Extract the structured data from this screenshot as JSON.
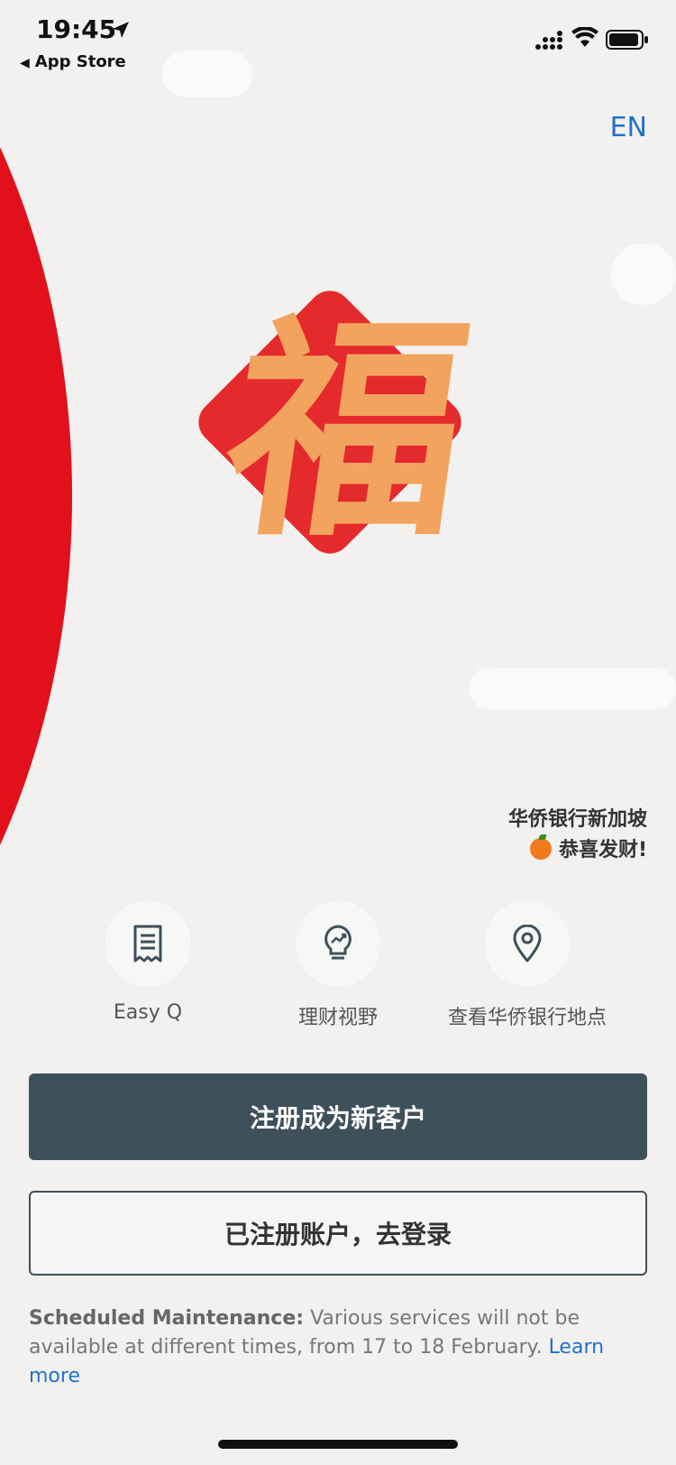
{
  "status_bar": {
    "time": "19:45",
    "back_app": "App Store",
    "icons": [
      "location-arrow-icon",
      "cellular-signal-icon",
      "wifi-icon",
      "battery-icon"
    ]
  },
  "header": {
    "language_toggle": "EN"
  },
  "hero": {
    "character": "福",
    "greeting_line1": "华侨银行新加坡",
    "greeting_line2": "恭喜发财!",
    "greeting_icon": "mandarin-orange-icon"
  },
  "quick_actions": [
    {
      "label": "Easy Q",
      "icon": "receipt-icon"
    },
    {
      "label": "理财视野",
      "icon": "lightbulb-growth-icon"
    },
    {
      "label": "查看华侨银行地点",
      "icon": "location-pin-icon"
    }
  ],
  "buttons": {
    "register_label": "注册成为新客户",
    "login_label": "已注册账户，去登录"
  },
  "maintenance": {
    "title": "Scheduled Maintenance:",
    "message": "Various services will not be available at different times, from 17 to 18 February.",
    "link": "Learn more"
  },
  "colors": {
    "accent_red": "#e2101a",
    "primary_button": "#3e505a",
    "link_blue": "#1f73c9",
    "fu_gold": "#f2a45e",
    "fu_red": "#e52a2d"
  }
}
